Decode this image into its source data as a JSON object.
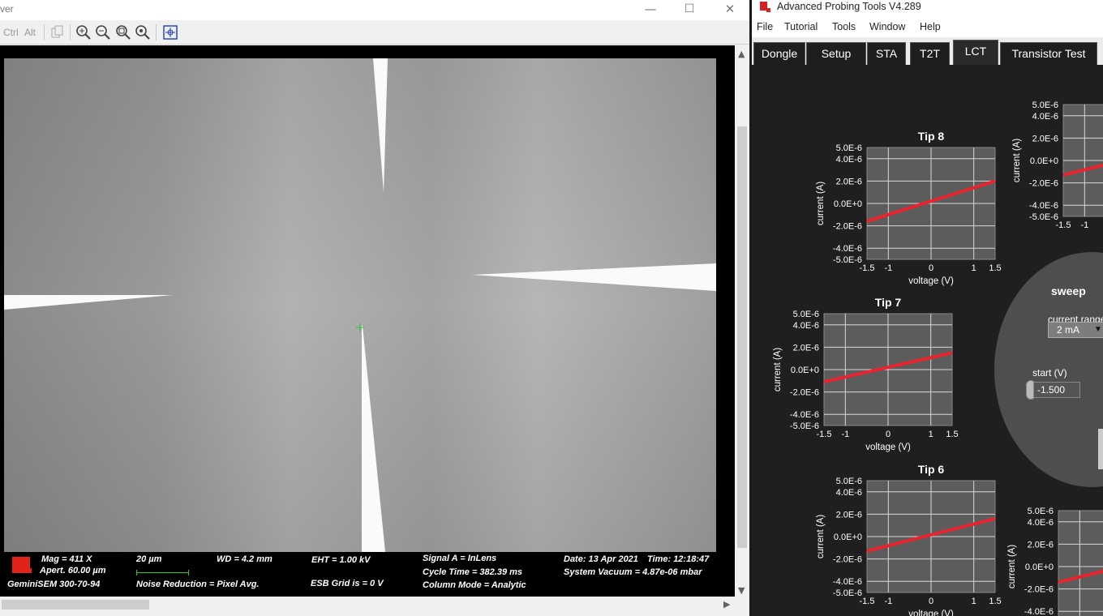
{
  "viewer": {
    "title_fragment": "ver",
    "window_controls": {
      "minimize": "—",
      "maximize": "☐",
      "close": "✕"
    },
    "toolbar": {
      "ctrl_label": "Ctrl",
      "alt_label": "Alt"
    }
  },
  "sem_info": {
    "mag": "Mag =   411 X",
    "aperture": "Apert.    60.00 µm",
    "scale_bar": "20 µm",
    "wd": "WD =  4.2 mm",
    "eht": "EHT =  1.00 kV",
    "signal": "Signal A = InLens",
    "cycle_time": "Cycle Time = 382.39 ms",
    "date": "Date: 13 Apr 2021",
    "time": "Time: 12:18:47",
    "vacuum": "System Vacuum = 4.87e-06 mbar",
    "instrument": "GeminiSEM 300-70-94",
    "noise_reduction": "Noise Reduction = Pixel Avg.",
    "esb_grid": "ESB Grid is =     0 V",
    "column_mode": "Column Mode = Analytic"
  },
  "apt": {
    "title": "Advanced Probing Tools V4.289",
    "menu": [
      "File",
      "Tutorial",
      "Tools",
      "Window",
      "Help"
    ],
    "tabs": [
      "Dongle",
      "Setup",
      "STA",
      "T2T",
      "LCT",
      "Transistor Test"
    ],
    "active_tab": "LCT",
    "sweep_label": "sweep",
    "current_range_label": "current range",
    "current_range_value": "2 mA",
    "start_label": "start (V)",
    "start_value": "-1.500"
  },
  "colors": {
    "trace": "#e8242e",
    "plot_bg": "#5c5c5c",
    "panel_bg": "#1f1f1f",
    "sem_logo": "#e2231a",
    "scale_bar": "#22cc22"
  },
  "chart_data": [
    {
      "type": "line",
      "title": "Tip 8",
      "xlabel": "voltage (V)",
      "ylabel": "current (A)",
      "xlim": [
        -1.5,
        1.5
      ],
      "ylim": [
        -5e-06,
        5e-06
      ],
      "xticks": [
        "-1.5",
        "-1",
        "0",
        "1",
        "1.5"
      ],
      "yticks": [
        "5.0E-6",
        "4.0E-6",
        "2.0E-6",
        "0.0E+0",
        "-2.0E-6",
        "-4.0E-6",
        "-5.0E-6"
      ],
      "series": [
        {
          "x": [
            -1.5,
            1.5
          ],
          "y": [
            -1.6e-06,
            2e-06
          ]
        }
      ]
    },
    {
      "type": "line",
      "title": "Tip 7",
      "xlabel": "voltage (V)",
      "ylabel": "current (A)",
      "xlim": [
        -1.5,
        1.5
      ],
      "ylim": [
        -5e-06,
        5e-06
      ],
      "xticks": [
        "-1.5",
        "-1",
        "0",
        "1",
        "1.5"
      ],
      "yticks": [
        "5.0E-6",
        "4.0E-6",
        "2.0E-6",
        "0.0E+0",
        "-2.0E-6",
        "-4.0E-6",
        "-5.0E-6"
      ],
      "series": [
        {
          "x": [
            -1.5,
            1.5
          ],
          "y": [
            -1.1e-06,
            1.5e-06
          ]
        }
      ]
    },
    {
      "type": "line",
      "title": "Tip 6",
      "xlabel": "voltage (V)",
      "ylabel": "current (A)",
      "xlim": [
        -1.5,
        1.5
      ],
      "ylim": [
        -5e-06,
        5e-06
      ],
      "xticks": [
        "-1.5",
        "-1",
        "0",
        "1",
        "1.5"
      ],
      "yticks": [
        "5.0E-6",
        "4.0E-6",
        "2.0E-6",
        "0.0E+0",
        "-2.0E-6",
        "-4.0E-6",
        "-5.0E-6"
      ],
      "series": [
        {
          "x": [
            -1.5,
            1.5
          ],
          "y": [
            -1.3e-06,
            1.6e-06
          ]
        }
      ]
    },
    {
      "type": "line",
      "title": "",
      "xlabel": "",
      "ylabel": "current (A)",
      "xlim": [
        -1.5,
        1.5
      ],
      "ylim": [
        -5e-06,
        5e-06
      ],
      "xticks": [
        "-1.5",
        "-1"
      ],
      "yticks": [
        "5.0E-6",
        "4.0E-6",
        "2.0E-6",
        "0.0E+0",
        "-2.0E-6",
        "-4.0E-6",
        "-5.0E-6"
      ],
      "series": [
        {
          "x": [
            -1.5,
            1.5
          ],
          "y": [
            -1.3e-06,
            1.5e-06
          ]
        }
      ]
    },
    {
      "type": "line",
      "title": "",
      "xlabel": "",
      "ylabel": "current (A)",
      "xlim": [
        -1.5,
        1.5
      ],
      "ylim": [
        -5e-06,
        5e-06
      ],
      "xticks": [],
      "yticks": [
        "5.0E-6",
        "4.0E-6",
        "2.0E-6",
        "0.0E+0",
        "-2.0E-6",
        "-4.0E-6"
      ],
      "series": [
        {
          "x": [
            -1.5,
            1.5
          ],
          "y": [
            -1.4e-06,
            1.4e-06
          ]
        }
      ]
    }
  ]
}
